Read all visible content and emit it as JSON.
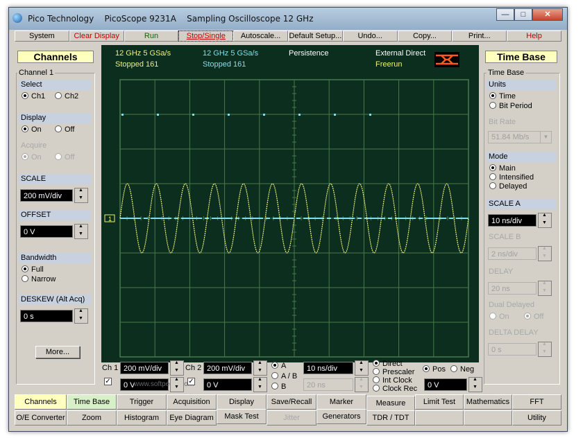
{
  "window": {
    "title": "Pico Technology    PicoScope 9231A    Sampling Oscilloscope 12 GHz",
    "minimize": "—",
    "maximize": "□",
    "close": "✕"
  },
  "menu": [
    {
      "label": "System"
    },
    {
      "label": "Clear Display"
    },
    {
      "label": "Run"
    },
    {
      "label": "Stop/Single"
    },
    {
      "label": "Autoscale..."
    },
    {
      "label": "Default Setup..."
    },
    {
      "label": "Undo..."
    },
    {
      "label": "Copy..."
    },
    {
      "label": "Print..."
    },
    {
      "label": "Help"
    }
  ],
  "channels": {
    "header": "Channels",
    "group": "Channel 1",
    "select": {
      "title": "Select",
      "ch1": "Ch1",
      "ch2": "Ch2"
    },
    "display": {
      "title": "Display",
      "on": "On",
      "off": "Off"
    },
    "acquire": {
      "title": "Acquire",
      "on": "On",
      "off": "Off"
    },
    "scale": {
      "title": "SCALE",
      "value": "200 mV/div"
    },
    "offset": {
      "title": "OFFSET",
      "value": "0 V"
    },
    "bandwidth": {
      "title": "Bandwidth",
      "full": "Full",
      "narrow": "Narrow"
    },
    "deskew": {
      "title": "DESKEW (Alt Acq)",
      "value": "0 s"
    },
    "more": "More..."
  },
  "scope": {
    "ch1_rate": "12 GHz  5 GSa/s",
    "ch1_state": "Stopped 161",
    "ch2_rate": "12 GHz  5 GSa/s",
    "ch2_state": "Stopped 161",
    "persistence": "Persistence",
    "trigger_mode": "External Direct",
    "trigger_state": "Freerun",
    "ch1_marker": "1",
    "colors": {
      "background": "#0b2e1e",
      "grid": "#4a7a4a",
      "ch1": "#f0f07c",
      "ch2": "#7ee0ec"
    },
    "signal": {
      "ch1_cycles": 12,
      "ch1_amplitude_div": 1.0,
      "ch2_level_div": 0
    }
  },
  "timebase": {
    "header": "Time Base",
    "group": "Time Base",
    "units": {
      "title": "Units",
      "time": "Time",
      "bit_period": "Bit Period"
    },
    "bit_rate": {
      "title": "Bit Rate",
      "value": "51.84 Mb/s"
    },
    "mode": {
      "title": "Mode",
      "main": "Main",
      "intensified": "Intensified",
      "delayed": "Delayed"
    },
    "scale_a": {
      "title": "SCALE A",
      "value": "10 ns/div"
    },
    "scale_b": {
      "title": "SCALE B",
      "value": "2 ns/div"
    },
    "delay": {
      "title": "DELAY",
      "value": "20 ns"
    },
    "dual_delayed": {
      "title": "Dual Delayed",
      "on": "On",
      "off": "Off"
    },
    "delta_delay": {
      "title": "DELTA DELAY",
      "value": "0 s"
    }
  },
  "bottom": {
    "ch1_label": "Ch 1",
    "ch1_scale": "200 mV/div",
    "ch1_offset": "0 V",
    "ch2_label": "Ch 2",
    "ch2_scale": "200 mV/div",
    "ch2_offset": "0 V",
    "tb_a": "A",
    "tb_ab": "A / B",
    "tb_b": "B",
    "tb_scale": "10 ns/div",
    "tb_delay": "20 ns",
    "trig_direct": "Direct",
    "trig_prescaler": "Prescaler",
    "trig_int_clock": "Int Clock",
    "trig_clock_rec": "Clock Rec",
    "pos": "Pos",
    "neg": "Neg",
    "trig_level": "0 V",
    "watermark": "www.softpedia.com"
  },
  "tabs_row1": [
    "Channels",
    "Time Base",
    "Trigger",
    "Acquisition",
    "Display",
    "Save/Recall",
    "Marker",
    "Measure",
    "Limit Test",
    "Mathematics",
    "FFT"
  ],
  "tabs_row2": [
    "O/E Converter",
    "Zoom",
    "Histogram",
    "Eye Diagram",
    "Mask Test",
    "Jitter",
    "Generators",
    "TDR / TDT",
    "",
    "",
    "Utility"
  ]
}
